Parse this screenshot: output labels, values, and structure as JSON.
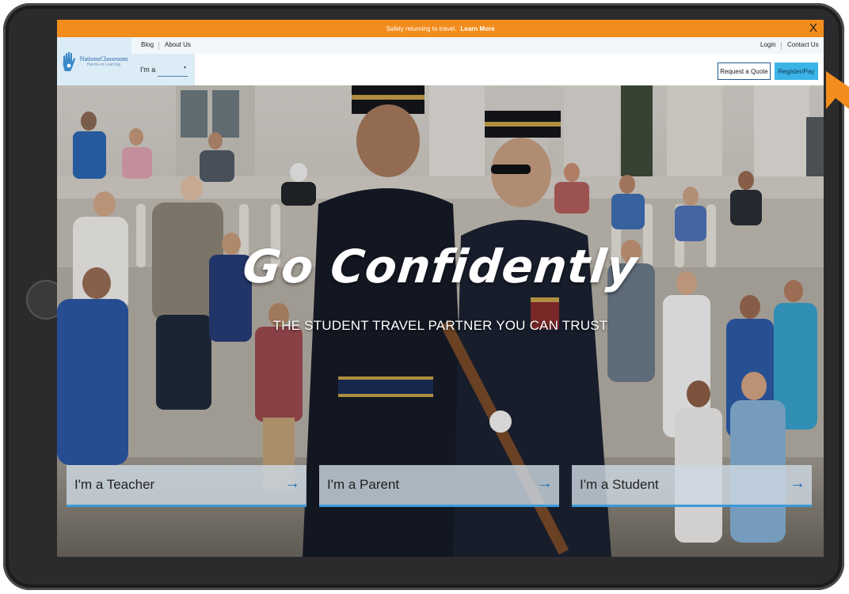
{
  "banner": {
    "message": "Safely returning to travel.",
    "link": "Learn More",
    "close": "X"
  },
  "header": {
    "logo": {
      "name": "NationsClassroom",
      "tagline": "Hands-on Learning",
      "icon": "hand-icon"
    },
    "nav": {
      "blog": "Blog",
      "about": "About Us",
      "login": "Login",
      "contact": "Contact Us"
    },
    "ima": {
      "label": "I'm a",
      "selected": "",
      "caret": "▾"
    },
    "request_quote": "Request a Quote",
    "register": "Register/Pay"
  },
  "hero": {
    "headline": "Go Confidently",
    "subheadline": "THE STUDENT TRAVEL PARTNER YOU CAN TRUST",
    "ctas": [
      {
        "label": "I'm a Teacher",
        "arrow": "→"
      },
      {
        "label": "I'm a Parent",
        "arrow": "→"
      },
      {
        "label": "I'm a Student",
        "arrow": "→"
      }
    ]
  },
  "colors": {
    "banner": "#f28c1c",
    "accent_blue": "#3bb4e8",
    "brand_blue": "#1f5fa5",
    "cta_underline": "#3a9ad9"
  }
}
